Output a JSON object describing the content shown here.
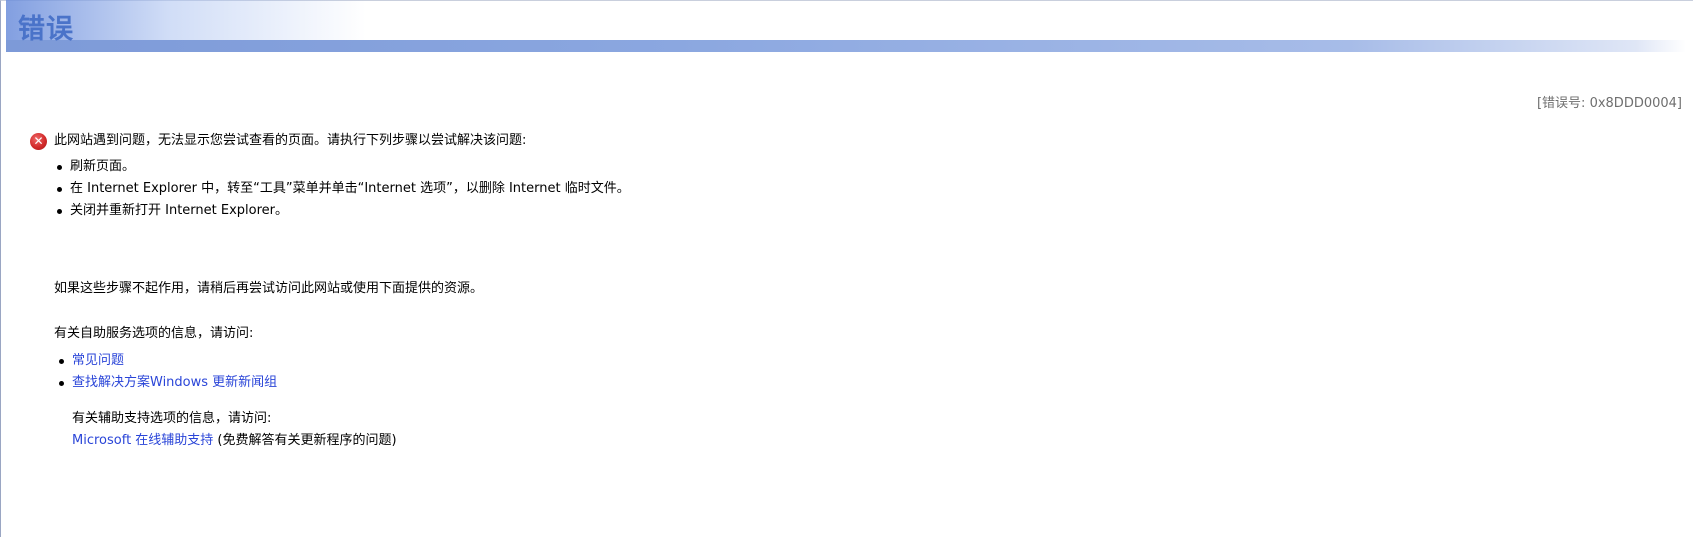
{
  "header": {
    "title": "错误"
  },
  "error_code": "[错误号: 0x8DDD0004]",
  "problem": {
    "icon": "error-x-icon",
    "text": "此网站遇到问题，无法显示您尝试查看的页面。请执行下列步骤以尝试解决该问题:"
  },
  "steps": [
    "刷新页面。",
    "在 Internet Explorer 中，转至“工具”菜单并单击“Internet 选项”，以删除 Internet 临时文件。",
    "关闭并重新打开 Internet Explorer。"
  ],
  "retry_text": "如果这些步骤不起作用，请稍后再尝试访问此网站或使用下面提供的资源。",
  "self_help": {
    "text": "有关自助服务选项的信息，请访问:",
    "links": [
      "常见问题",
      "查找解决方案Windows 更新新闻组"
    ]
  },
  "assisted": {
    "text": "有关辅助支持选项的信息，请访问:",
    "link": "Microsoft 在线辅助支持",
    "note": " (免费解答有关更新程序的问题)"
  },
  "colors": {
    "title": "#4a73c9",
    "link": "#2a45d8",
    "error_icon": "#d22b2b"
  }
}
